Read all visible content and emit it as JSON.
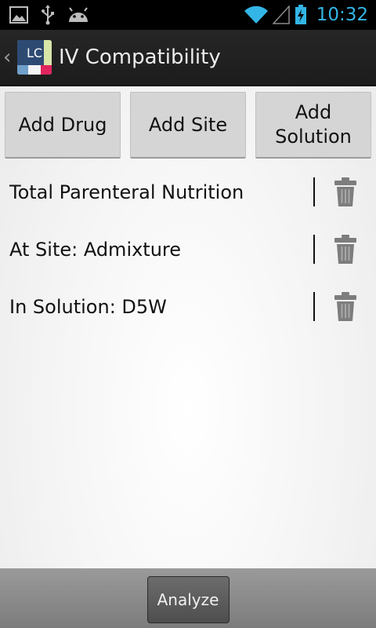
{
  "status_bar": {
    "time": "10:32",
    "icons": [
      "gallery-icon",
      "usb-icon",
      "android-icon",
      "wifi-icon",
      "signal-icon",
      "battery-charging-icon"
    ],
    "clock_color": "#33b5e5"
  },
  "action_bar": {
    "logo_text": "LC",
    "title": "IV Compatibility"
  },
  "buttons": {
    "add_drug": "Add Drug",
    "add_site": "Add Site",
    "add_solution": "Add\nSolution"
  },
  "items": [
    {
      "label": "Total Parenteral Nutrition",
      "icon": "trash-icon"
    },
    {
      "label": "At Site: Admixture",
      "icon": "trash-icon"
    },
    {
      "label": "In Solution: D5W",
      "icon": "trash-icon"
    }
  ],
  "footer": {
    "analyze_label": "Analyze"
  }
}
